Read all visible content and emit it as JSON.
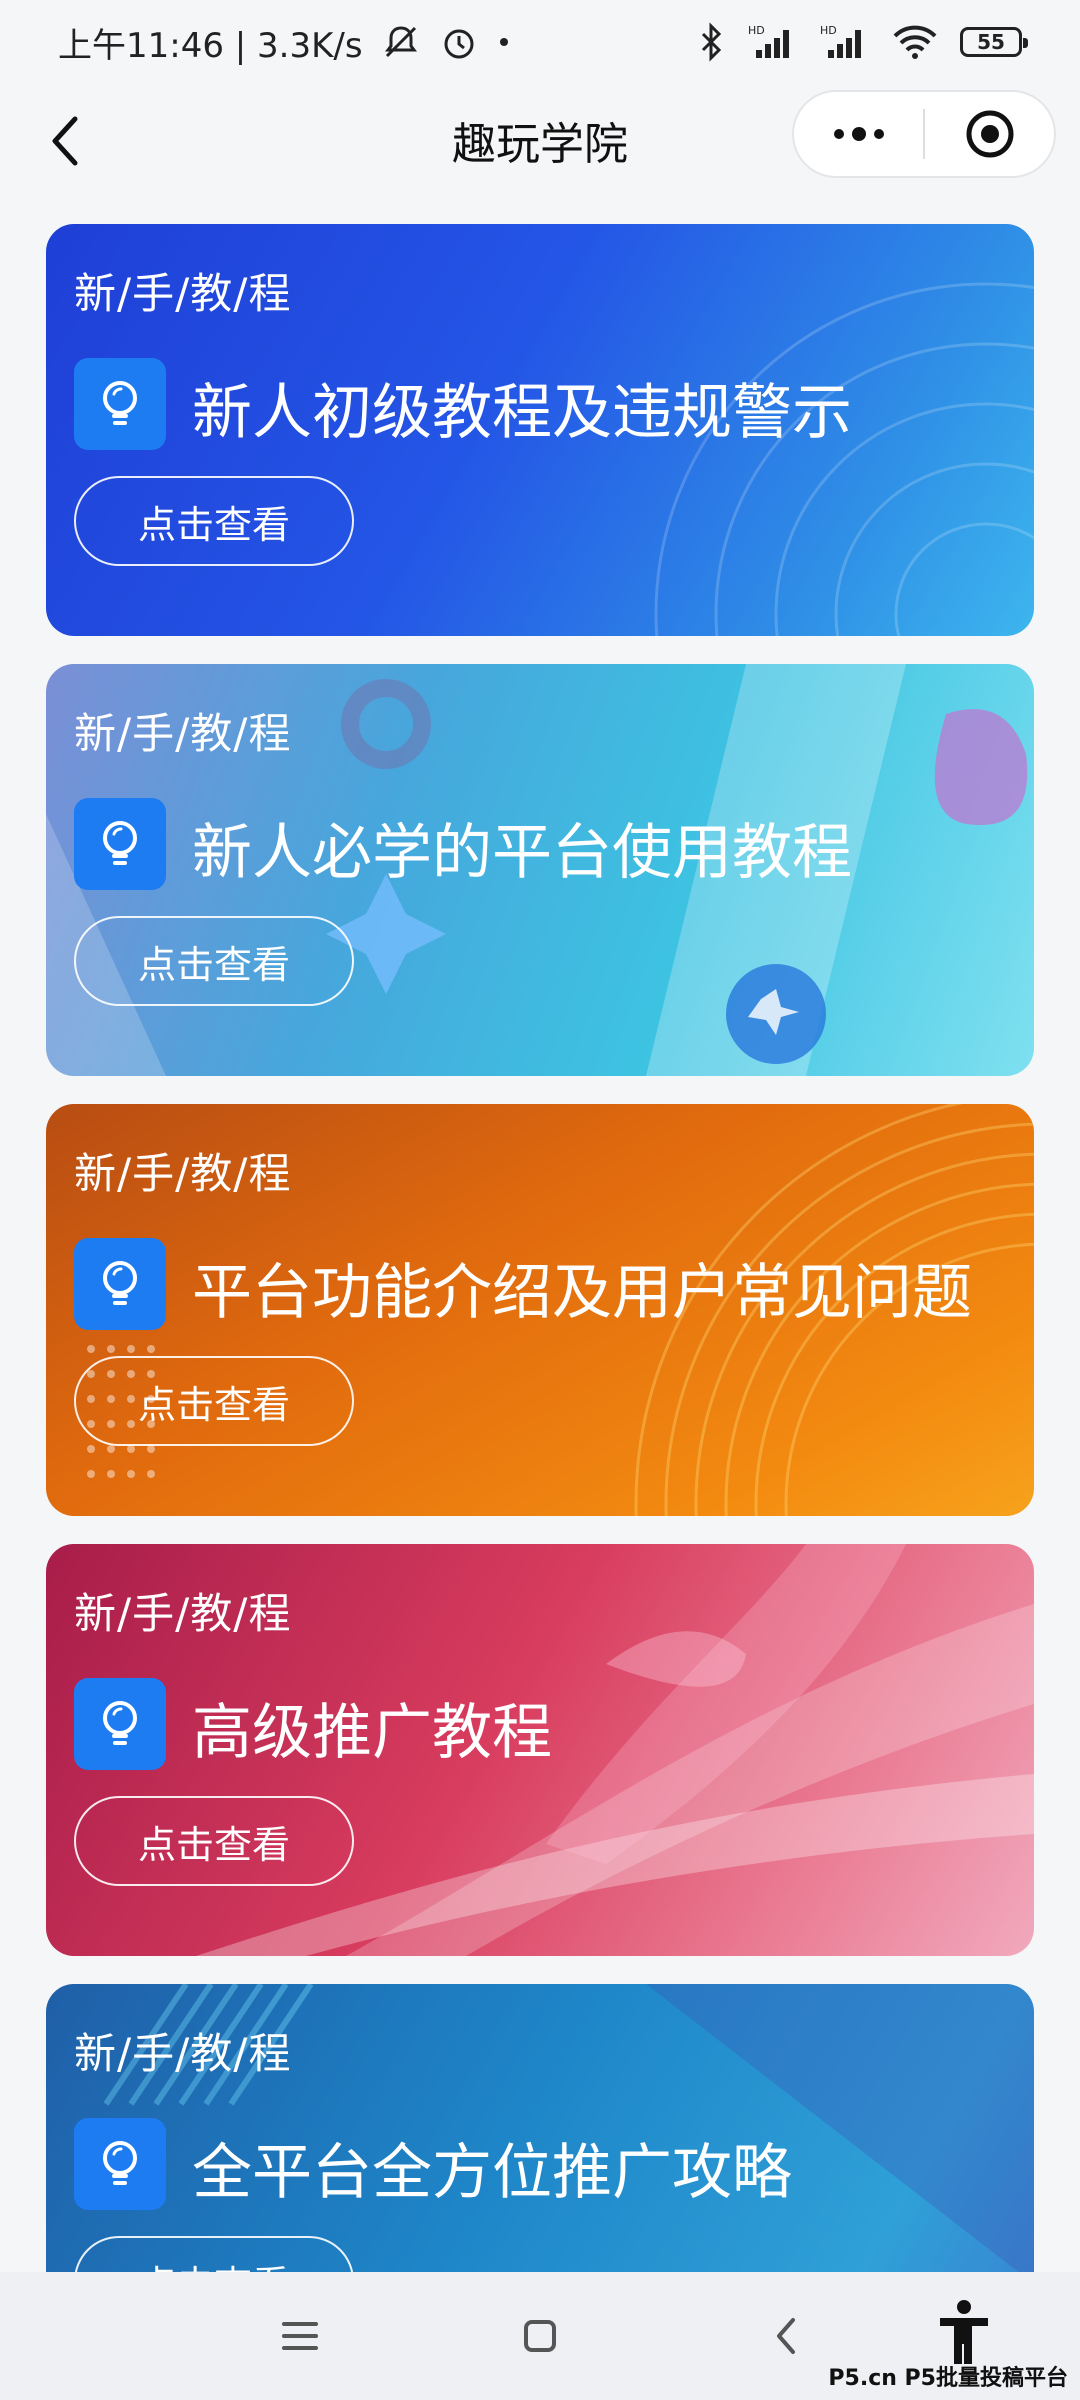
{
  "status_bar": {
    "time_text": "上午11:46 | 3.3K/s",
    "battery": "55"
  },
  "nav": {
    "title": "趣玩学院"
  },
  "cards": [
    {
      "tag": "新/手/教/程",
      "title": "新人初级教程及违规警示",
      "button": "点击查看"
    },
    {
      "tag": "新/手/教/程",
      "title": "新人必学的平台使用教程",
      "button": "点击查看"
    },
    {
      "tag": "新/手/教/程",
      "title": "平台功能介绍及用户常见问题",
      "button": "点击查看"
    },
    {
      "tag": "新/手/教/程",
      "title": "高级推广教程",
      "button": "点击查看"
    },
    {
      "tag": "新/手/教/程",
      "title": "全平台全方位推广攻略",
      "button": "点击查看"
    }
  ],
  "watermark": "P5.cn P5批量投稿平台",
  "colors": {
    "bulb_bg": "#1d7cf2",
    "page_bg": "#f5f6f8"
  }
}
